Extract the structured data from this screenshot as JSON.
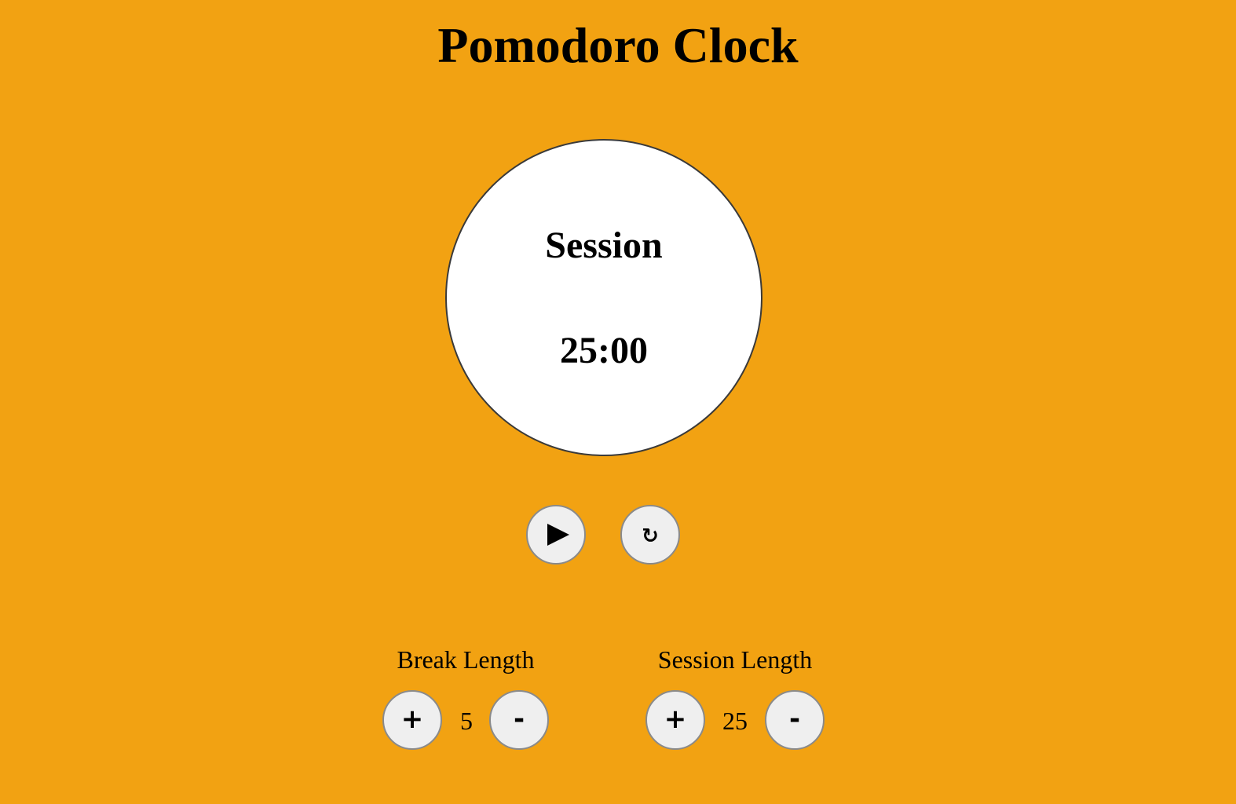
{
  "app": {
    "title": "Pomodoro Clock",
    "background_color": "#F2A212"
  },
  "clock": {
    "mode_label": "Session",
    "time_display": "25:00"
  },
  "controls": {
    "play_icon": "play-icon",
    "play_glyph": "▶",
    "reset_icon": "refresh-icon",
    "reset_glyph": "↻"
  },
  "break_setting": {
    "label": "Break Length",
    "value": "5",
    "increment_label": "+",
    "decrement_label": "-"
  },
  "session_setting": {
    "label": "Session Length",
    "value": "25",
    "increment_label": "+",
    "decrement_label": "-"
  }
}
